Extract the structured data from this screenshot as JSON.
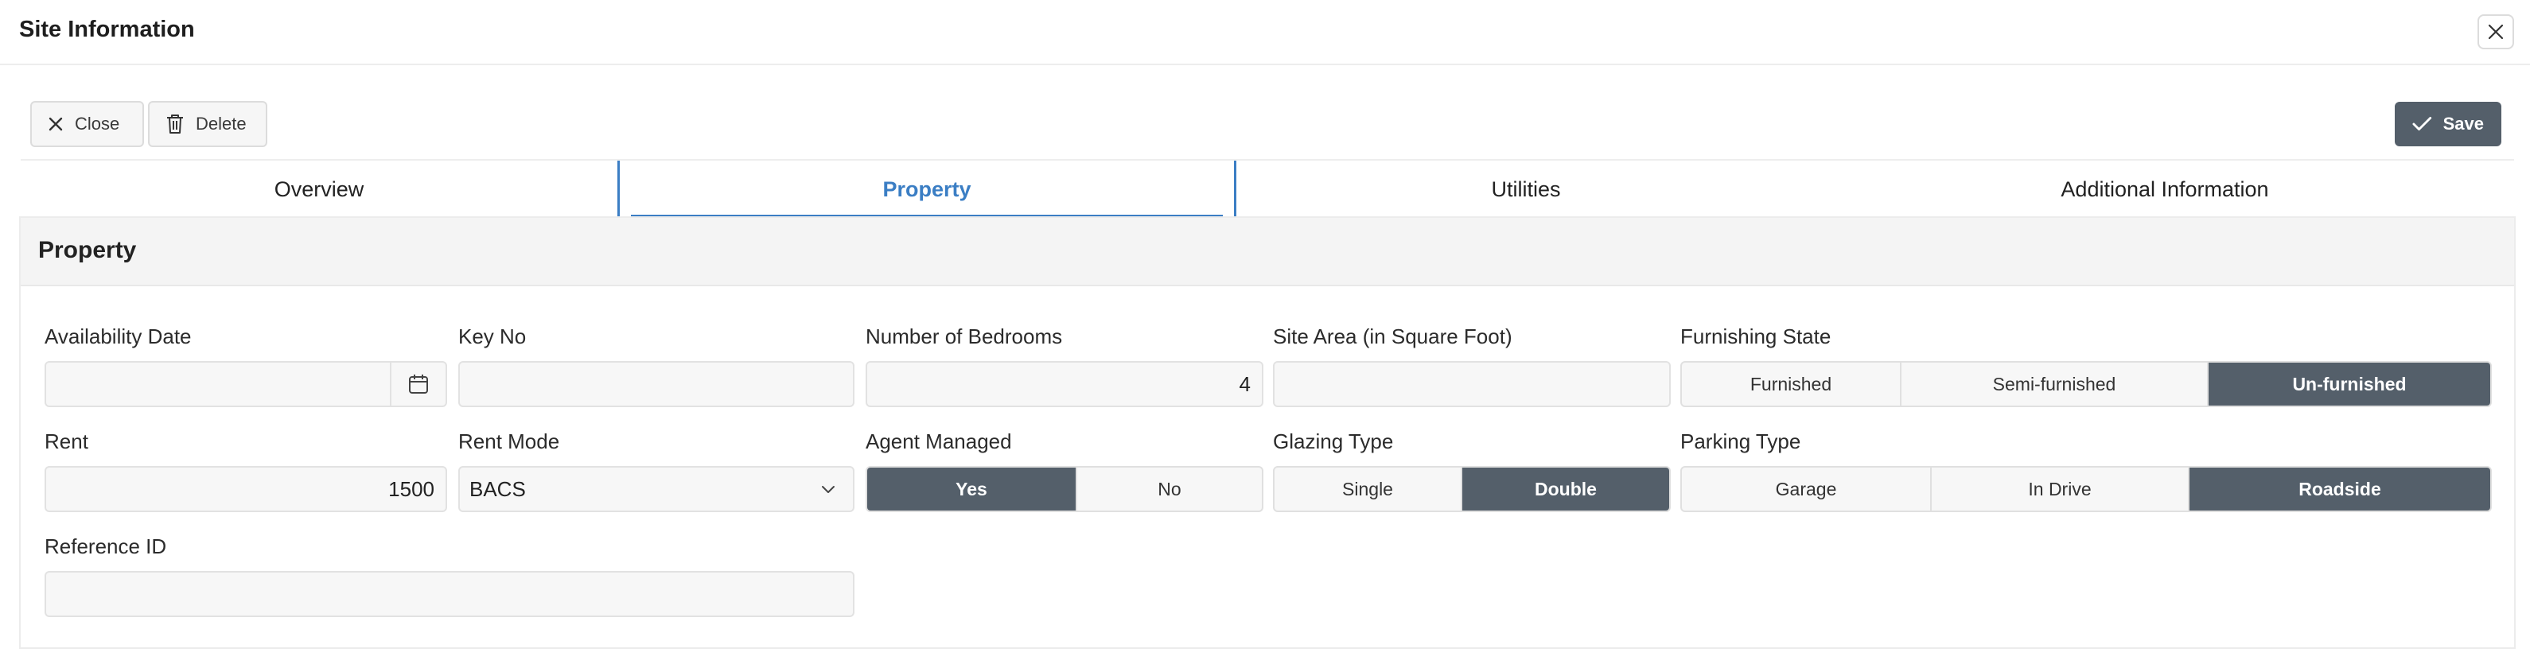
{
  "dialog": {
    "title": "Site Information",
    "close_icon": "close-icon"
  },
  "toolbar": {
    "close_label": "Close",
    "delete_label": "Delete",
    "save_label": "Save"
  },
  "tabs": [
    {
      "label": "Overview",
      "active": false
    },
    {
      "label": "Property",
      "active": true
    },
    {
      "label": "Utilities",
      "active": false
    },
    {
      "label": "Additional Information",
      "active": false
    }
  ],
  "section": {
    "title": "Property"
  },
  "fields": {
    "availability_date": {
      "label": "Availability Date",
      "value": ""
    },
    "key_no": {
      "label": "Key No",
      "value": ""
    },
    "bedrooms": {
      "label": "Number of Bedrooms",
      "value": "4"
    },
    "site_area": {
      "label": "Site Area (in Square Foot)",
      "value": ""
    },
    "furnishing": {
      "label": "Furnishing State",
      "options": [
        "Furnished",
        "Semi-furnished",
        "Un-furnished"
      ],
      "selected": "Un-furnished"
    },
    "rent": {
      "label": "Rent",
      "value": "1500"
    },
    "rent_mode": {
      "label": "Rent Mode",
      "value": "BACS"
    },
    "agent_managed": {
      "label": "Agent Managed",
      "options": [
        "Yes",
        "No"
      ],
      "selected": "Yes"
    },
    "glazing": {
      "label": "Glazing Type",
      "options": [
        "Single",
        "Double"
      ],
      "selected": "Double"
    },
    "parking": {
      "label": "Parking Type",
      "options": [
        "Garage",
        "In Drive",
        "Roadside"
      ],
      "selected": "Roadside"
    },
    "reference_id": {
      "label": "Reference ID",
      "value": ""
    }
  },
  "colors": {
    "accent": "#3b7ec4",
    "selected": "#545f6a"
  }
}
